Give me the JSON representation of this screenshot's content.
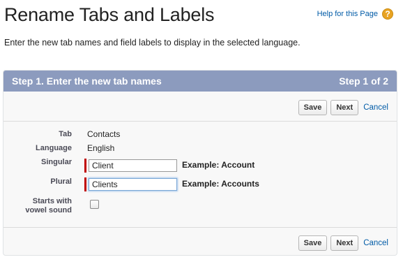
{
  "page": {
    "title": "Rename Tabs and Labels",
    "help_label": "Help for this Page",
    "help_icon": "?",
    "intro": "Enter the new tab names and field labels to display in the selected language."
  },
  "panel": {
    "step_title": "Step 1. Enter the new tab names",
    "step_count": "Step 1 of 2",
    "header_color": "#8c9bbe"
  },
  "buttons": {
    "save": "Save",
    "next": "Next",
    "cancel": "Cancel"
  },
  "form": {
    "tab": {
      "label": "Tab",
      "value": "Contacts"
    },
    "language": {
      "label": "Language",
      "value": "English"
    },
    "singular": {
      "label": "Singular",
      "value": "Client",
      "example": "Example: Account"
    },
    "plural": {
      "label": "Plural",
      "value": "Clients",
      "example": "Example: Accounts"
    },
    "vowel": {
      "label_line1": "Starts with",
      "label_line2": "vowel sound",
      "checked": false
    }
  },
  "colors": {
    "required": "#c00000",
    "link": "#015ba7",
    "help_icon": "#e8a323"
  }
}
